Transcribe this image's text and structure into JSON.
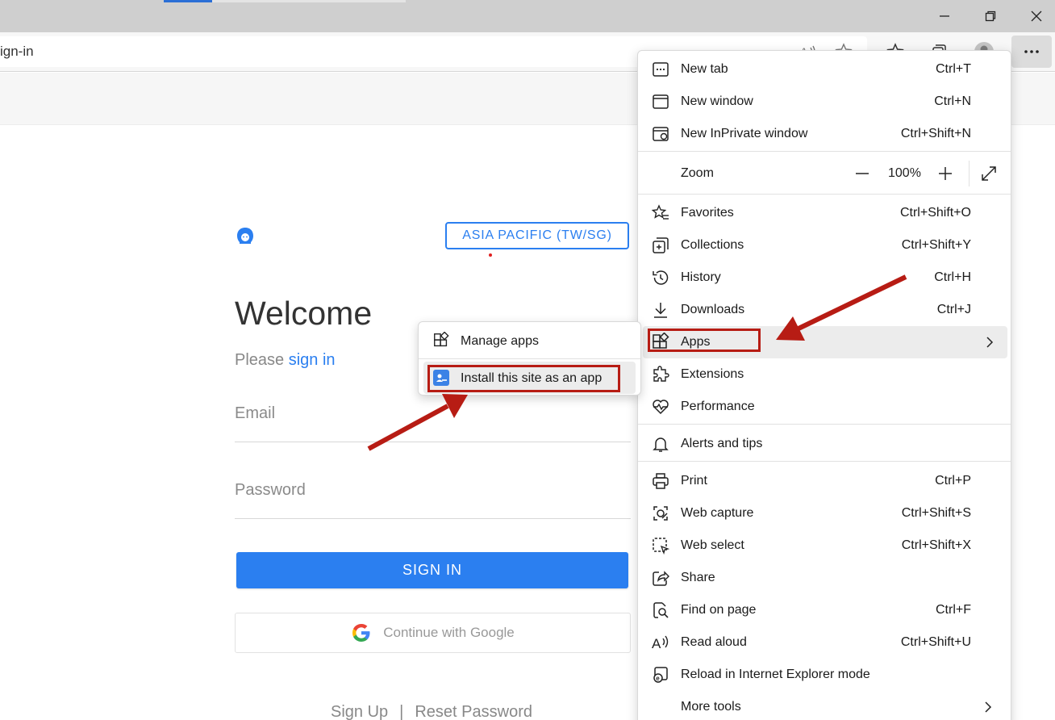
{
  "browser": {
    "url_fragment": "ign-in",
    "menu_button_label": "···"
  },
  "page": {
    "region_button": "ASIA PACIFIC (TW/SG)",
    "welcome": "Welcome",
    "please_text": "Please",
    "sign_in_link": "sign in",
    "email_label": "Email",
    "password_label": "Password",
    "signin_button": "SIGN IN",
    "google_button": "Continue with Google",
    "signup_link": "Sign Up",
    "footer_separator": "|",
    "reset_link": "Reset Password"
  },
  "menu": {
    "new_tab": {
      "label": "New tab",
      "shortcut": "Ctrl+T"
    },
    "new_window": {
      "label": "New window",
      "shortcut": "Ctrl+N"
    },
    "inprivate": {
      "label": "New InPrivate window",
      "shortcut": "Ctrl+Shift+N"
    },
    "zoom": {
      "label": "Zoom",
      "value": "100%"
    },
    "favorites": {
      "label": "Favorites",
      "shortcut": "Ctrl+Shift+O"
    },
    "collections": {
      "label": "Collections",
      "shortcut": "Ctrl+Shift+Y"
    },
    "history": {
      "label": "History",
      "shortcut": "Ctrl+H"
    },
    "downloads": {
      "label": "Downloads",
      "shortcut": "Ctrl+J"
    },
    "apps": {
      "label": "Apps"
    },
    "extensions": {
      "label": "Extensions"
    },
    "performance": {
      "label": "Performance"
    },
    "alerts": {
      "label": "Alerts and tips"
    },
    "print": {
      "label": "Print",
      "shortcut": "Ctrl+P"
    },
    "web_capture": {
      "label": "Web capture",
      "shortcut": "Ctrl+Shift+S"
    },
    "web_select": {
      "label": "Web select",
      "shortcut": "Ctrl+Shift+X"
    },
    "share": {
      "label": "Share"
    },
    "find": {
      "label": "Find on page",
      "shortcut": "Ctrl+F"
    },
    "read_aloud": {
      "label": "Read aloud",
      "shortcut": "Ctrl+Shift+U"
    },
    "ie_mode": {
      "label": "Reload in Internet Explorer mode"
    },
    "more_tools": {
      "label": "More tools"
    }
  },
  "submenu": {
    "manage_apps": "Manage apps",
    "install_app": "Install this site as an app"
  },
  "colors": {
    "accent_blue": "#2b7ff0",
    "annotation_red": "#b71c14"
  }
}
